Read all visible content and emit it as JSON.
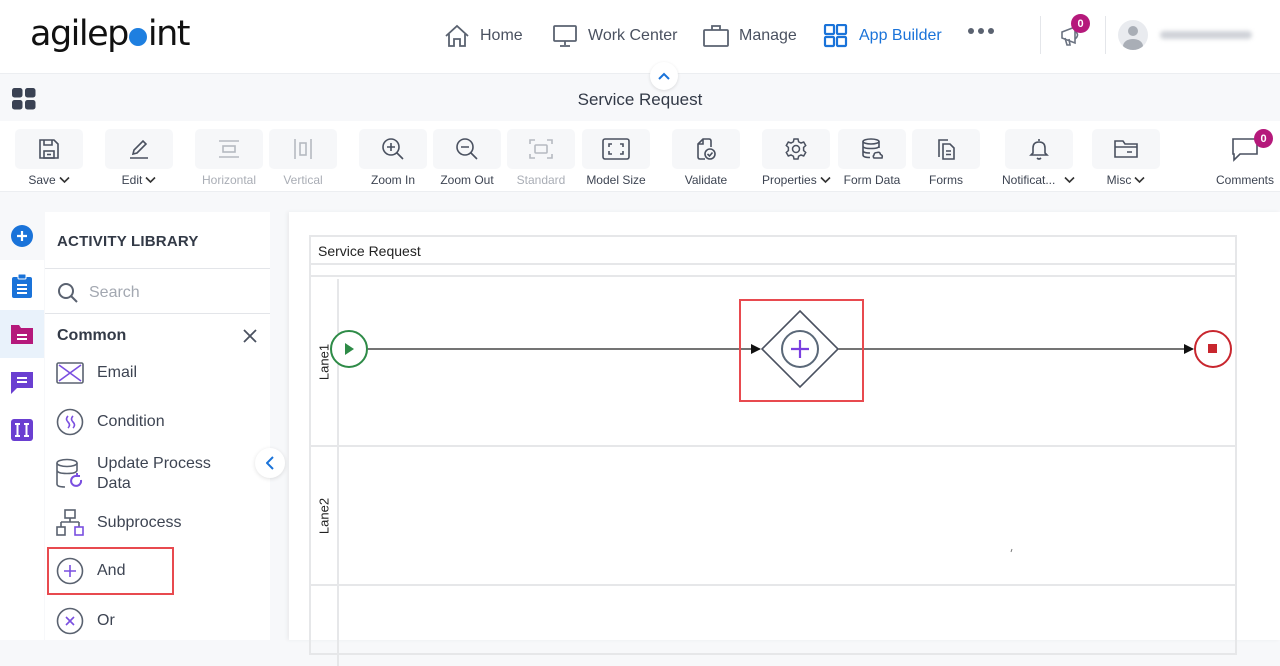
{
  "brand": {
    "logo_text_before": "agilep",
    "logo_text_after": "int",
    "accent": "#1e7fe0"
  },
  "nav": {
    "items": [
      {
        "label": "Home",
        "icon": "home-icon"
      },
      {
        "label": "Work Center",
        "icon": "monitor-icon"
      },
      {
        "label": "Manage",
        "icon": "briefcase-icon"
      },
      {
        "label": "App Builder",
        "icon": "app-grid-icon",
        "active": true
      }
    ],
    "more_icon": "more-horizontal-icon",
    "announcements_count": "0",
    "user_name": "(blurred)"
  },
  "title_bar": {
    "title": "Service Request"
  },
  "toolbar": {
    "items": [
      {
        "label": "Save",
        "icon": "save-icon",
        "dropdown": true
      },
      {
        "label": "Edit",
        "icon": "pencil-icon",
        "dropdown": true
      },
      {
        "label": "Horizontal",
        "icon": "horizontal-layout-icon",
        "disabled": true
      },
      {
        "label": "Vertical",
        "icon": "vertical-layout-icon",
        "disabled": true
      },
      {
        "label": "Zoom In",
        "icon": "zoom-in-icon"
      },
      {
        "label": "Zoom Out",
        "icon": "zoom-out-icon"
      },
      {
        "label": "Standard",
        "icon": "standard-size-icon",
        "disabled": true
      },
      {
        "label": "Model Size",
        "icon": "model-size-icon"
      },
      {
        "label": "Validate",
        "icon": "validate-icon"
      },
      {
        "label": "Properties",
        "icon": "gear-icon",
        "dropdown": true
      },
      {
        "label": "Form Data",
        "icon": "database-icon"
      },
      {
        "label": "Forms",
        "icon": "forms-icon"
      },
      {
        "label": "Notificat...",
        "icon": "bell-icon",
        "dropdown": true
      },
      {
        "label": "Misc",
        "icon": "folder-icon",
        "dropdown": true
      },
      {
        "label": "Comments",
        "icon": "comment-icon",
        "count": "0"
      }
    ]
  },
  "rail": {
    "items": [
      {
        "name": "add",
        "color": "#1a73d9"
      },
      {
        "name": "clipboard",
        "color": "#1a73d9"
      },
      {
        "name": "folder",
        "color": "#b5197b",
        "selected": true
      },
      {
        "name": "message",
        "color": "#6a3fd1"
      },
      {
        "name": "variable",
        "color": "#6a3fd1"
      }
    ]
  },
  "library": {
    "title": "ACTIVITY LIBRARY",
    "search_placeholder": "Search",
    "group": "Common",
    "items": [
      {
        "label": "Email",
        "icon": "email-icon"
      },
      {
        "label": "Condition",
        "icon": "condition-icon"
      },
      {
        "label": "Update Process\nData",
        "icon": "update-process-data-icon"
      },
      {
        "label": "Subprocess",
        "icon": "subprocess-icon"
      },
      {
        "label": "And",
        "icon": "and-gateway-icon",
        "highlighted": true
      },
      {
        "label": "Or",
        "icon": "or-gateway-icon"
      }
    ]
  },
  "canvas": {
    "pool_name": "Service Request",
    "lanes": [
      "Lane1",
      "Lane2",
      ""
    ],
    "shapes": [
      {
        "type": "start-event",
        "lane": "Lane1",
        "color": "#2e8b47"
      },
      {
        "type": "and-gateway",
        "lane": "Lane1",
        "highlighted": true
      },
      {
        "type": "end-event",
        "lane": "Lane1",
        "color": "#c8262e"
      }
    ],
    "connections": [
      {
        "from": "start-event",
        "to": "and-gateway"
      },
      {
        "from": "and-gateway",
        "to": "end-event"
      }
    ]
  },
  "colors": {
    "highlight": "#e84a4f",
    "badge": "#b5197b",
    "active_nav": "#1a73d9"
  }
}
